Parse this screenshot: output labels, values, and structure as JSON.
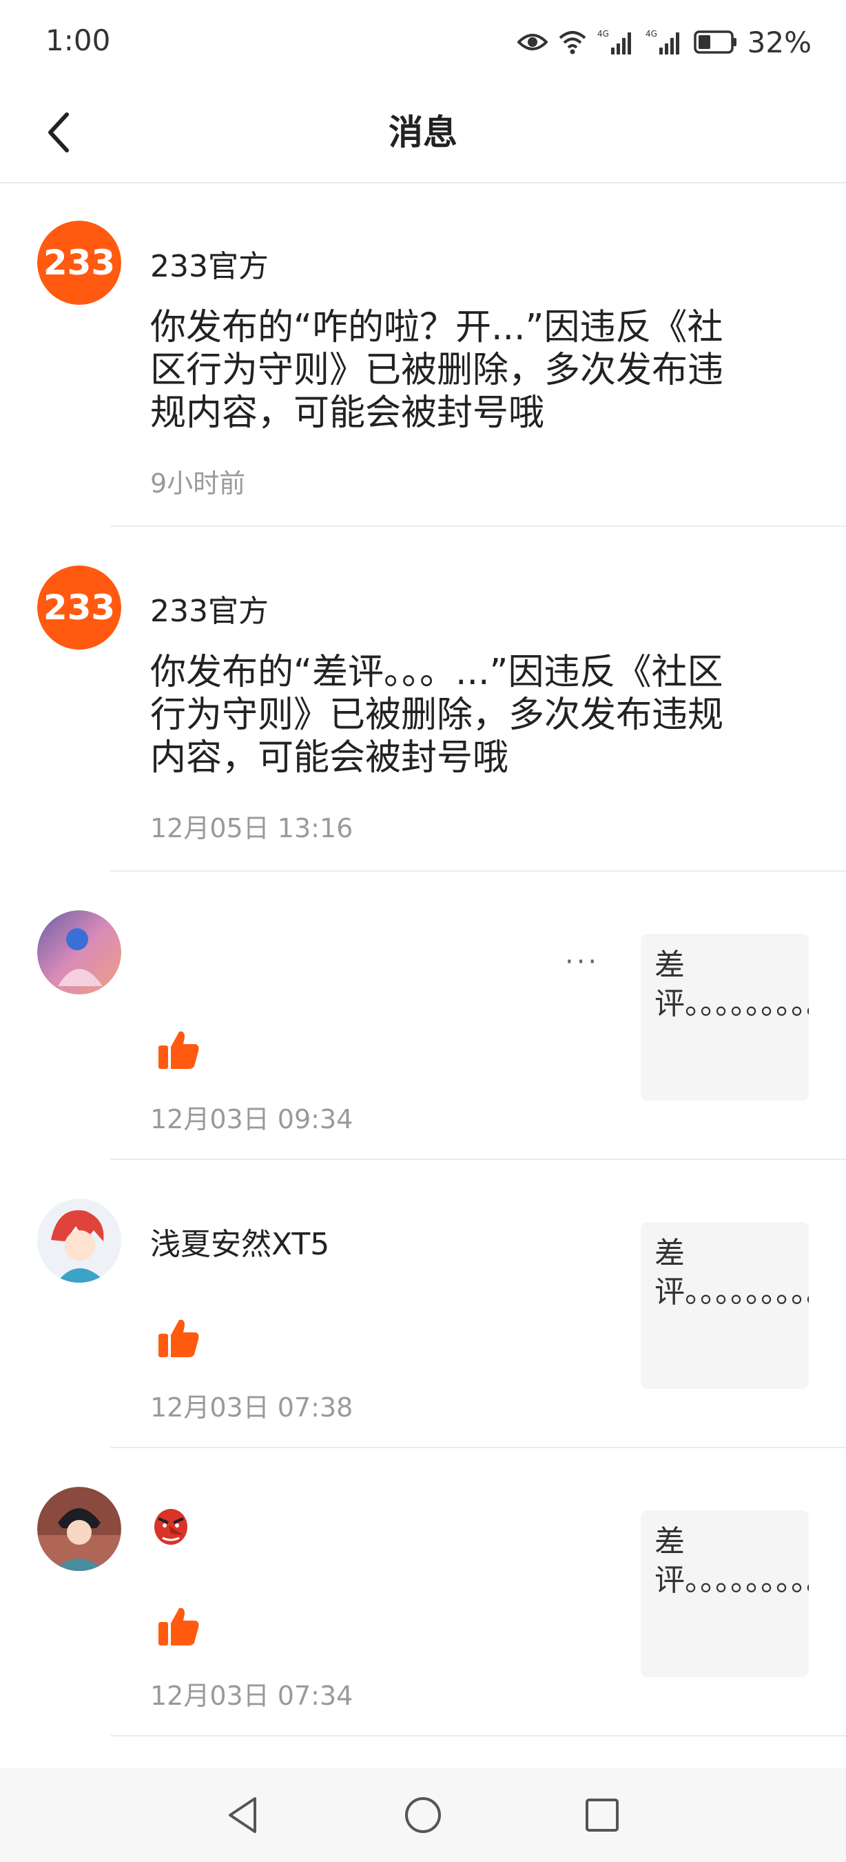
{
  "status_bar": {
    "time": "1:00",
    "battery_percent": "32%",
    "icons": [
      "eye-icon",
      "wifi-icon",
      "signal-4g-icon",
      "signal-4g-icon",
      "battery-icon"
    ]
  },
  "header": {
    "title": "消息",
    "back_icon": "chevron-left-icon"
  },
  "messages": [
    {
      "sender": "233官方",
      "avatar_text": "233",
      "avatar_color": "#ff5a10",
      "text": "你发布的“咋的啦？开...”因违反《社区行为守则》已被删除，多次发布违规内容，可能会被封号哦",
      "time": "9小时前"
    },
    {
      "sender": "233官方",
      "avatar_text": "233",
      "avatar_color": "#ff5a10",
      "text": "你发布的“差评。。。...”因违反《社区行为守则》已被删除，多次发布违规内容，可能会被封号哦",
      "time": "12月05日 13:16"
    },
    {
      "sender": "",
      "more": "···",
      "action_icon": "thumbs-up-icon",
      "quote": "差评。。。。。。。。。…",
      "time": "12月03日 09:34"
    },
    {
      "sender": "浅夏安然XT5",
      "action_icon": "thumbs-up-icon",
      "quote": "差评。。。。。。。。。…",
      "time": "12月03日 07:38"
    },
    {
      "sender_emoji_icon": "tengu-mask-icon",
      "action_icon": "thumbs-up-icon",
      "quote": "差评。。。。。。。。。…",
      "time": "12月03日 07:34"
    }
  ],
  "nav_bar": {
    "buttons": [
      "back-triangle-icon",
      "home-circle-icon",
      "recents-square-icon"
    ]
  },
  "colors": {
    "accent": "#ff5a10",
    "divider": "#ececec",
    "muted_text": "#9a9a9a",
    "quote_bg": "#f5f5f5"
  }
}
